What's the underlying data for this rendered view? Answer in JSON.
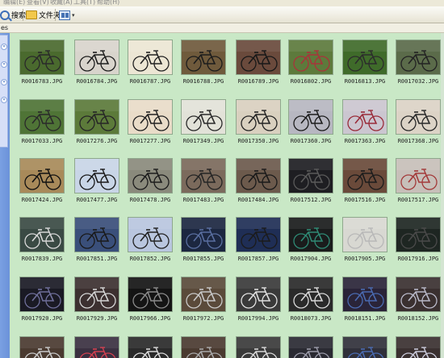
{
  "window": {
    "menu_items": [
      "编辑(E)",
      "查看(V)",
      "收藏(A)",
      "工具(T)",
      "帮助(H)"
    ]
  },
  "toolbar": {
    "search_label": "搜索",
    "folders_label": "文件夹",
    "views_icon": "views-icon"
  },
  "address": {
    "label": "es"
  },
  "task_pane": {
    "sections": [
      "chevron-icon",
      "chevron-icon",
      "chevron-icon",
      "chevron-icon"
    ]
  },
  "files": [
    {
      "name": "R0016783.JPG",
      "bg": "#4a6a2e",
      "frame": "#2a2a2a"
    },
    {
      "name": "R0016784.JPG",
      "bg": "#d8d4cc",
      "frame": "#1e1e1e"
    },
    {
      "name": "R0016787.JPG",
      "bg": "#ece6d4",
      "frame": "#222222"
    },
    {
      "name": "R0016788.JPG",
      "bg": "#6f5a3c",
      "frame": "#1c1c1c"
    },
    {
      "name": "R0016789.JPG",
      "bg": "#6a4a3c",
      "frame": "#181818"
    },
    {
      "name": "R0016802.JPG",
      "bg": "#5d7a3c",
      "frame": "#a8343a"
    },
    {
      "name": "R0016813.JPG",
      "bg": "#3f6b2a",
      "frame": "#2c2c2c"
    },
    {
      "name": "R0017032.JPG",
      "bg": "#5b6b4a",
      "frame": "#232323"
    },
    {
      "name": "R0017033.JPG",
      "bg": "#4f7436",
      "frame": "#2a2a2a"
    },
    {
      "name": "R0017276.JPG",
      "bg": "#5c7a3a",
      "frame": "#262626"
    },
    {
      "name": "R0017277.JPG",
      "bg": "#e9dcc8",
      "frame": "#222222"
    },
    {
      "name": "R0017349.JPG",
      "bg": "#e2e2d8",
      "frame": "#2a2a2a"
    },
    {
      "name": "R0017350.JPG",
      "bg": "#d9d0bf",
      "frame": "#252525"
    },
    {
      "name": "R0017360.JPG",
      "bg": "#b7b7c1",
      "frame": "#1d1d1d"
    },
    {
      "name": "R0017363.JPG",
      "bg": "#cbc6d0",
      "frame": "#9a2c3a"
    },
    {
      "name": "R0017368.JPG",
      "bg": "#dcd3c6",
      "frame": "#2a2a2a"
    },
    {
      "name": "R0017424.JPG",
      "bg": "#a88a5a",
      "frame": "#111111"
    },
    {
      "name": "R0017477.JPG",
      "bg": "#c8d5e6",
      "frame": "#1a1a1a"
    },
    {
      "name": "R0017478.JPG",
      "bg": "#8a8a7c",
      "frame": "#1c1c1c"
    },
    {
      "name": "R0017483.JPG",
      "bg": "#7b6a5c",
      "frame": "#252525"
    },
    {
      "name": "R0017484.JPG",
      "bg": "#6c5a4c",
      "frame": "#1a1a1a"
    },
    {
      "name": "R0017512.JPG",
      "bg": "#1e1e22",
      "frame": "#5a5a5a"
    },
    {
      "name": "R0017516.JPG",
      "bg": "#6a4a3a",
      "frame": "#1c1c1c"
    },
    {
      "name": "R0017517.JPG",
      "bg": "#c7bfb9",
      "frame": "#a33a3a"
    },
    {
      "name": "R0017839.JPG",
      "bg": "#3a4a44",
      "frame": "#d8d8d8"
    },
    {
      "name": "R0017851.JPG",
      "bg": "#3a4f7a",
      "frame": "#1a1a1a"
    },
    {
      "name": "R0017852.JPG",
      "bg": "#b9c6df",
      "frame": "#222222"
    },
    {
      "name": "R0017855.JPG",
      "bg": "#1c2740",
      "frame": "#5a6fa0"
    },
    {
      "name": "R0017857.JPG",
      "bg": "#1f2e55",
      "frame": "#1b1b1b"
    },
    {
      "name": "R0017904.JPG",
      "bg": "#1a1c1c",
      "frame": "#2f8a74"
    },
    {
      "name": "R0017905.JPG",
      "bg": "#d8d8d2",
      "frame": "#b8b8b8"
    },
    {
      "name": "R0017916.JPG",
      "bg": "#1e2622",
      "frame": "#4a4a4a"
    },
    {
      "name": "R0017920.JPG",
      "bg": "#1a1a24",
      "frame": "#6f6f9a"
    },
    {
      "name": "R0017929.JPG",
      "bg": "#3c3030",
      "frame": "#d4d4d4"
    },
    {
      "name": "R0017966.JPG",
      "bg": "#141414",
      "frame": "#8a8a8a"
    },
    {
      "name": "R0017972.JPG",
      "bg": "#5a4a3a",
      "frame": "#c8c8c8"
    },
    {
      "name": "R0017994.JPG",
      "bg": "#3a3a3a",
      "frame": "#e0e0e0"
    },
    {
      "name": "R0018073.JPG",
      "bg": "#2a2a2a",
      "frame": "#d8d8d8"
    },
    {
      "name": "R0018151.JPG",
      "bg": "#2a2438",
      "frame": "#4a6ab0"
    },
    {
      "name": "R0018152.JPG",
      "bg": "#3a3030",
      "frame": "#b8b8c8"
    },
    {
      "name": "",
      "bg": "#4a3a30",
      "frame": "#c8c8c8"
    },
    {
      "name": "",
      "bg": "#3a3040",
      "frame": "#d04050"
    },
    {
      "name": "",
      "bg": "#2a2a2a",
      "frame": "#d8d8d8"
    },
    {
      "name": "",
      "bg": "#4a3a30",
      "frame": "#a8a8a8"
    },
    {
      "name": "",
      "bg": "#3a3a3a",
      "frame": "#d8d8d8"
    },
    {
      "name": "",
      "bg": "#2a2a32",
      "frame": "#9a9aa8"
    },
    {
      "name": "",
      "bg": "#30303a",
      "frame": "#4a6ab0"
    },
    {
      "name": "",
      "bg": "#3a3030",
      "frame": "#c8c8d8"
    }
  ]
}
